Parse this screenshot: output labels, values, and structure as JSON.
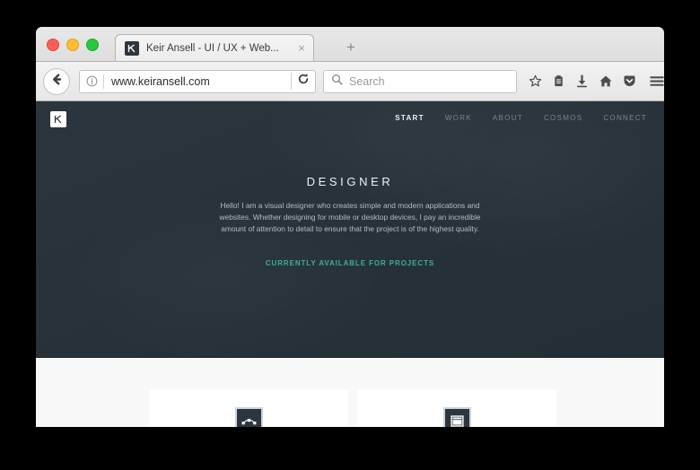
{
  "window": {
    "traffic_lights": [
      {
        "name": "close",
        "color": "#ff5f57"
      },
      {
        "name": "minimize",
        "color": "#febc2e"
      },
      {
        "name": "zoom",
        "color": "#28c840"
      }
    ]
  },
  "tabs": {
    "active_tab": {
      "title": "Keir Ansell - UI / UX + Web...",
      "favicon": "k-monogram-favicon",
      "close_label": "×"
    },
    "new_tab_label": "+"
  },
  "toolbar": {
    "back_icon": "back-arrow-icon",
    "url": {
      "info_icon": "info-icon",
      "value": "www.keiransell.com",
      "reload_icon": "reload-icon"
    },
    "search": {
      "icon": "search-icon",
      "placeholder": "Search",
      "value": ""
    },
    "icons": [
      {
        "name": "bookmark-star-icon",
        "label": "Bookmark"
      },
      {
        "name": "reading-list-icon",
        "label": "Reading List"
      },
      {
        "name": "downloads-icon",
        "label": "Downloads"
      },
      {
        "name": "home-icon",
        "label": "Home"
      },
      {
        "name": "pocket-icon",
        "label": "Pocket"
      }
    ],
    "menu_icon": "hamburger-menu-icon"
  },
  "site": {
    "logo": "k-monogram-logo",
    "nav": [
      {
        "label": "START",
        "active": true
      },
      {
        "label": "WORK",
        "active": false
      },
      {
        "label": "ABOUT",
        "active": false
      },
      {
        "label": "COSMOS",
        "active": false
      },
      {
        "label": "CONNECT",
        "active": false
      }
    ],
    "hero": {
      "title": "DESIGNER",
      "description": "Hello! I am a visual designer who creates simple and modern applications and websites. Whether designing for mobile or desktop devices, I pay an incredible amount of attention to detail to ensure that the project is of the highest quality.",
      "cta": "CURRENTLY AVAILABLE FOR PROJECTS",
      "accent_color": "#3fae97",
      "background_color": "#273139"
    },
    "cards": [
      {
        "icon": "bezier-curve-icon"
      },
      {
        "icon": "browser-window-icon"
      }
    ]
  }
}
